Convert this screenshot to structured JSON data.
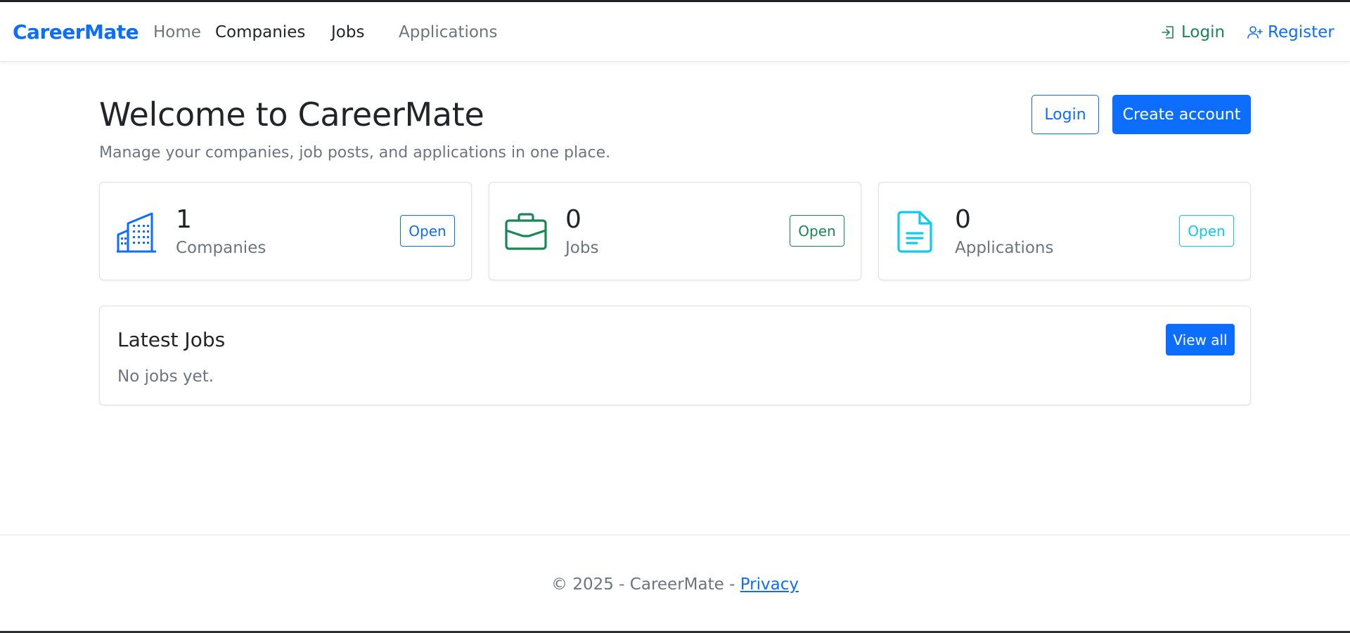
{
  "nav": {
    "brand": "CareerMate",
    "links": [
      "Home",
      "Companies",
      "Jobs",
      "Applications"
    ],
    "login": "Login",
    "register": "Register"
  },
  "hero": {
    "title": "Welcome to CareerMate",
    "subtitle": "Manage your companies, job posts, and applications in one place.",
    "login_button": "Login",
    "create_button": "Create account"
  },
  "stats": [
    {
      "count": "1",
      "label": "Companies",
      "button": "Open",
      "icon": "building-icon",
      "color": "#0d6efd"
    },
    {
      "count": "0",
      "label": "Jobs",
      "button": "Open",
      "icon": "briefcase-icon",
      "color": "#198754"
    },
    {
      "count": "0",
      "label": "Applications",
      "button": "Open",
      "icon": "document-icon",
      "color": "#0dcaf0"
    }
  ],
  "latest_jobs": {
    "title": "Latest Jobs",
    "empty_text": "No jobs yet.",
    "view_all": "View all"
  },
  "footer": {
    "copyright": "© 2025 - CareerMate - ",
    "privacy": "Privacy"
  },
  "colors": {
    "primary": "#0d6efd",
    "success": "#198754",
    "info": "#0dcaf0",
    "muted": "#6c757d"
  }
}
